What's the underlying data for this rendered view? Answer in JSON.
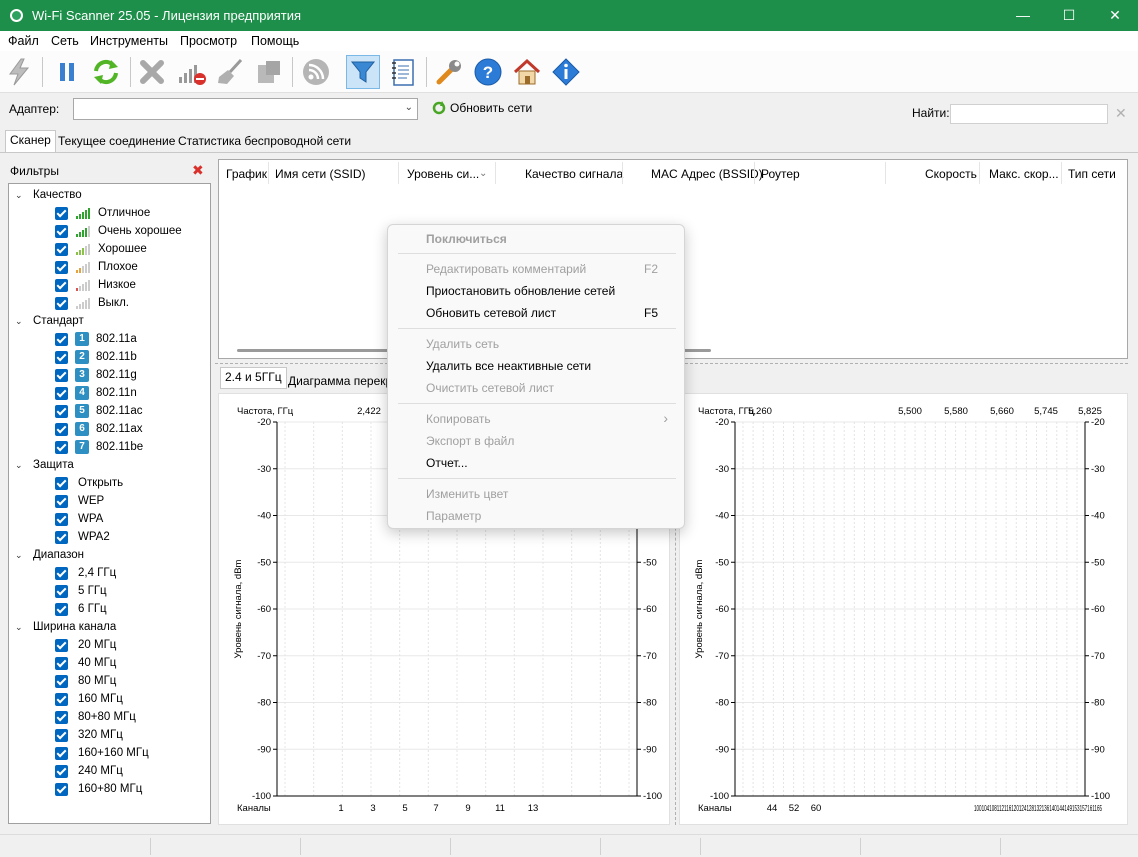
{
  "window": {
    "title": "Wi-Fi Scanner 25.05 - Лицензия предприятия",
    "minimize": "—",
    "maximize": "☐",
    "close": "✕"
  },
  "menu": [
    "Файл",
    "Сеть",
    "Инструменты",
    "Просмотр",
    "Помощь"
  ],
  "toolbar": {
    "icons": [
      "lightning-icon",
      "pause-icon",
      "refresh-icon",
      "delete-icon",
      "signal-remove-icon",
      "broom-icon",
      "packages-icon",
      "rss-icon",
      "filter-icon",
      "notebook-icon",
      "wrench-icon",
      "help-icon",
      "home-icon",
      "info-icon"
    ]
  },
  "adapter": {
    "label": "Адаптер:",
    "value": "",
    "refresh_label": "Обновить сети",
    "find_label": "Найти:",
    "find_value": ""
  },
  "tabs": [
    "Сканер",
    "Текущее соединение",
    "Статистика беспроводной сети"
  ],
  "filters": {
    "title": "Фильтры",
    "groups": [
      {
        "label": "Качество",
        "items": [
          "Отличное",
          "Очень хорошее",
          "Хорошее",
          "Плохое",
          "Низкое",
          "Выкл."
        ]
      },
      {
        "label": "Стандарт",
        "items": [
          "802.11a",
          "802.11b",
          "802.11g",
          "802.11n",
          "802.11ac",
          "802.11ax",
          "802.11be"
        ],
        "badges": [
          "1",
          "2",
          "3",
          "4",
          "5",
          "6",
          "7"
        ]
      },
      {
        "label": "Защита",
        "items": [
          "Открыть",
          "WEP",
          "WPA",
          "WPA2"
        ]
      },
      {
        "label": "Диапазон",
        "items": [
          "2,4 ГГц",
          "5 ГГц",
          "6 ГГц"
        ]
      },
      {
        "label": "Ширина канала",
        "items": [
          "20 МГц",
          "40 МГц",
          "80 МГц",
          "160 МГц",
          "80+80 МГц",
          "320 МГц",
          "160+160 МГц",
          "240 МГц",
          "160+80 МГц"
        ]
      }
    ]
  },
  "table": {
    "columns": [
      "График",
      "Имя сети (SSID)",
      "Уровень си...",
      "Качество сигнала",
      "MAC Адрес (BSSID)",
      "Роутер",
      "Скорость",
      "Макс. скор...",
      "Тип сети"
    ]
  },
  "graph_tabs": [
    "2.4 и 5ГГц",
    "Диаграмма перекр"
  ],
  "context_menu": {
    "items": [
      {
        "label": "Поключиться",
        "enabled": false,
        "bold": true
      },
      {
        "label": "Редактировать комментарий",
        "shortcut": "F2",
        "enabled": false
      },
      {
        "label": "Приостановить обновление сетей",
        "enabled": true
      },
      {
        "label": "Обновить сетевой лист",
        "shortcut": "F5",
        "enabled": true
      },
      {
        "label": "Удалить сеть",
        "enabled": false
      },
      {
        "label": "Удалить все неактивные сети",
        "enabled": true
      },
      {
        "label": "Очистить сетевой лист",
        "enabled": false
      },
      {
        "label": "Копировать",
        "enabled": false,
        "submenu": "›"
      },
      {
        "label": "Экспорт в файл",
        "enabled": false
      },
      {
        "label": "Отчет...",
        "enabled": true
      },
      {
        "label": "Изменить цвет",
        "enabled": false
      },
      {
        "label": "Параметр",
        "enabled": false
      }
    ]
  },
  "chart_data": [
    {
      "type": "line",
      "title": "",
      "freq_label": "Частота, ГГц",
      "freq_ticks": [
        "2,422"
      ],
      "xlabel": "Каналы",
      "x_ticks": [
        "1",
        "3",
        "5",
        "7",
        "9",
        "11",
        "13"
      ],
      "ylabel": "Уровень сигнала, dBm",
      "ylim": [
        -100,
        -20
      ],
      "y_ticks": [
        "-20",
        "-30",
        "-40",
        "-50",
        "-60",
        "-70",
        "-80",
        "-90",
        "-100"
      ],
      "grid": true,
      "series": []
    },
    {
      "type": "line",
      "title": "",
      "freq_label": "Частота, ГГц",
      "freq_ticks": [
        "5,260",
        "5,500",
        "5,580",
        "5,660",
        "5,745",
        "5,825"
      ],
      "xlabel": "Каналы",
      "x_ticks": [
        "44",
        "52",
        "60",
        "100104108112116120124128132136140144149153157161165"
      ],
      "ylabel": "Уровень сигнала, dBm",
      "ylim": [
        -100,
        -20
      ],
      "y_ticks": [
        "-20",
        "-30",
        "-40",
        "-50",
        "-60",
        "-70",
        "-80",
        "-90",
        "-100"
      ],
      "grid": true,
      "series": []
    }
  ]
}
